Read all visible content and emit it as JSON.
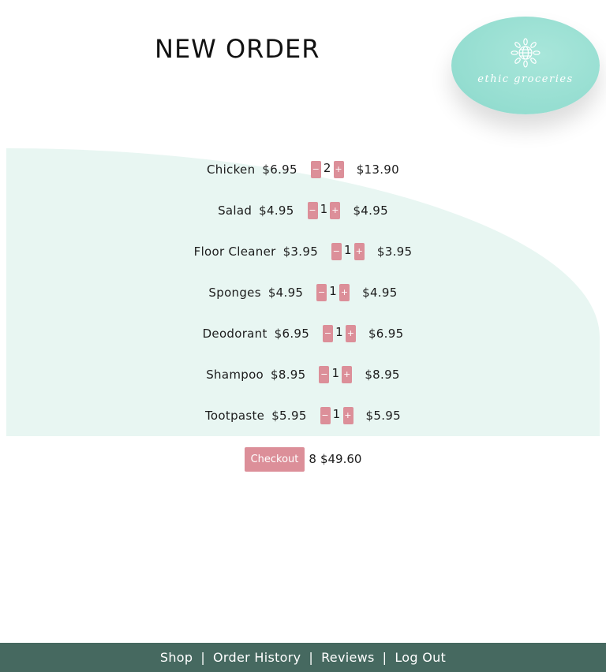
{
  "header": {
    "title": "NEW ORDER"
  },
  "logo": {
    "text": "ethic groceries",
    "icon": "globe-sunflower-icon"
  },
  "steppers": {
    "minus": "−",
    "plus": "+"
  },
  "order_items": [
    {
      "name": "Chicken",
      "price": "$6.95",
      "quantity": "2",
      "subtotal": "$13.90"
    },
    {
      "name": "Salad",
      "price": "$4.95",
      "quantity": "1",
      "subtotal": "$4.95"
    },
    {
      "name": "Floor Cleaner",
      "price": "$3.95",
      "quantity": "1",
      "subtotal": "$3.95"
    },
    {
      "name": "Sponges",
      "price": "$4.95",
      "quantity": "1",
      "subtotal": "$4.95"
    },
    {
      "name": "Deodorant",
      "price": "$6.95",
      "quantity": "1",
      "subtotal": "$6.95"
    },
    {
      "name": "Shampoo",
      "price": "$8.95",
      "quantity": "1",
      "subtotal": "$8.95"
    },
    {
      "name": "Tootpaste",
      "price": "$5.95",
      "quantity": "1",
      "subtotal": "$5.95"
    }
  ],
  "checkout": {
    "button_label": "Checkout",
    "total_count": "8",
    "total_price": "$49.60"
  },
  "footer": {
    "links": [
      "Shop",
      "Order History",
      "Reviews",
      "Log Out"
    ],
    "separator": "|"
  },
  "colors": {
    "accent_pink": "#dc8f99",
    "logo_teal": "#94ddd0",
    "panel_mint": "#e8f6f2",
    "footer_green": "#466960"
  }
}
